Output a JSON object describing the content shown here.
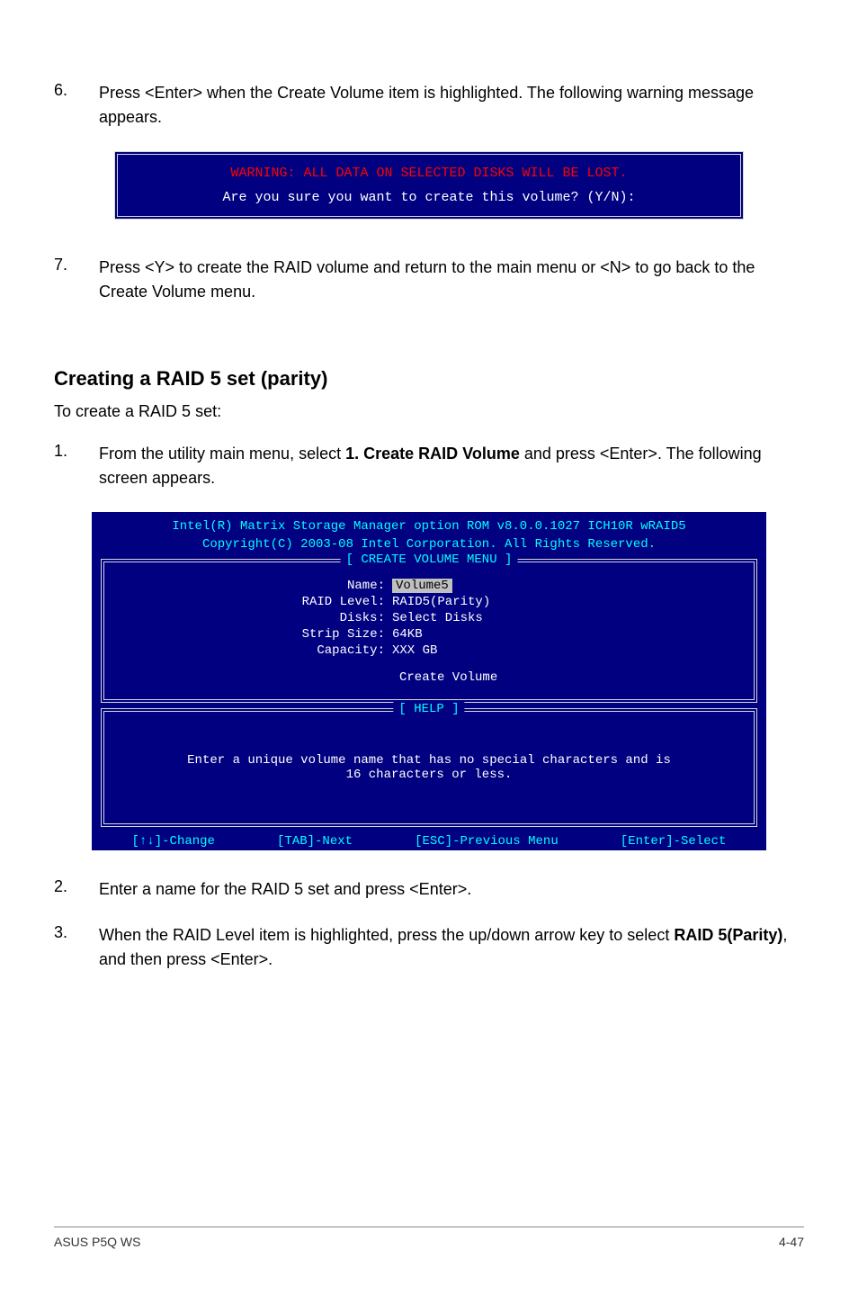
{
  "step6": {
    "num": "6.",
    "text": "Press <Enter> when the Create Volume item is highlighted. The following warning message appears."
  },
  "warning": {
    "red": "WARNING: ALL DATA ON SELECTED DISKS WILL BE LOST.",
    "white": "Are you sure you want to create this volume? (Y/N):"
  },
  "step7": {
    "num": "7.",
    "text": "Press <Y> to create the RAID volume and return to the main menu or <N> to go back to the Create Volume menu."
  },
  "heading": "Creating a RAID 5 set (parity)",
  "intro": "To create a RAID 5 set:",
  "step1": {
    "num": "1.",
    "text_before": "From the utility main menu, select ",
    "text_bold": "1. Create RAID Volume",
    "text_after": " and press <Enter>. The following screen appears."
  },
  "bios": {
    "header1": "Intel(R) Matrix Storage Manager option ROM v8.0.0.1027 ICH10R wRAID5",
    "header2": "Copyright(C) 2003-08 Intel Corporation. All Rights Reserved.",
    "create_menu_label": "[ CREATE VOLUME MENU ]",
    "fields": {
      "name_label": "Name:",
      "name_value": "Volume5",
      "raid_label": "RAID Level:",
      "raid_value": "RAID5(Parity)",
      "disks_label": "Disks:",
      "disks_value": "Select Disks",
      "strip_label": "Strip Size:",
      "strip_value": "64KB",
      "capacity_label": "Capacity:",
      "capacity_value": "XXX  GB"
    },
    "create_volume": "Create Volume",
    "help_label": "[ HELP ]",
    "help_line1": "Enter a unique volume name that has no special characters and is",
    "help_line2": "16 characters or less.",
    "footer": {
      "change": "[↑↓]-Change",
      "next": "[TAB]-Next",
      "prev": "[ESC]-Previous Menu",
      "select": "[Enter]-Select"
    }
  },
  "step2": {
    "num": "2.",
    "text": "Enter a name for the RAID 5 set and press <Enter>."
  },
  "step3": {
    "num": "3.",
    "text_before": "When the RAID Level item is highlighted, press the up/down arrow key to select ",
    "text_bold": "RAID 5(Parity)",
    "text_after": ", and then press <Enter>."
  },
  "footer": {
    "left": "ASUS P5Q WS",
    "right": "4-47"
  }
}
